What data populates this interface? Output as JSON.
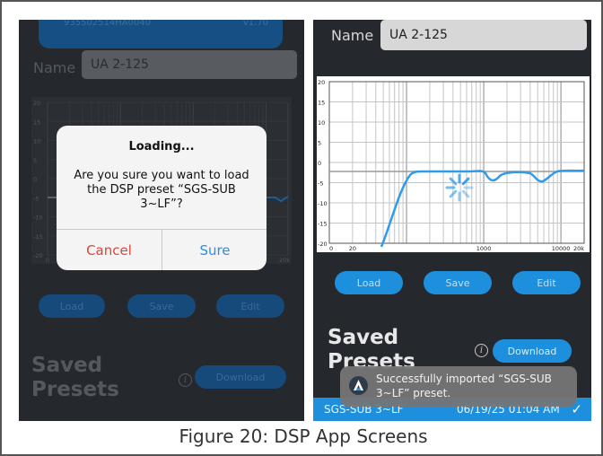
{
  "caption": "Figure 20: DSP App Screens",
  "left_screen": {
    "serial_number": "935502514HA0040",
    "firmware_version": "v1.70",
    "name_label": "Name",
    "name_value": "UA 2-125",
    "buttons": {
      "load": "Load",
      "save": "Save",
      "edit": "Edit",
      "download": "Download"
    },
    "saved_presets_title_line1": "Saved",
    "saved_presets_title_line2": "Presets",
    "info_glyph": "i",
    "modal": {
      "title": "Loading...",
      "message": "Are you sure you want to load the DSP preset “SGS-SUB 3~LF”?",
      "cancel_label": "Cancel",
      "sure_label": "Sure"
    },
    "plot_y_ticks": [
      "20",
      "15",
      "10",
      "5",
      "0",
      "-5",
      "-10",
      "-15",
      "-20"
    ],
    "plot_x_ticks": [
      "0",
      "20k"
    ]
  },
  "right_screen": {
    "name_label": "Name",
    "name_value": "UA 2-125",
    "buttons": {
      "load": "Load",
      "save": "Save",
      "edit": "Edit",
      "download": "Download"
    },
    "saved_presets_title_line1": "Saved",
    "saved_presets_title_line2": "Presets",
    "info_glyph": "i",
    "plot_y_ticks": [
      "20",
      "15",
      "10",
      "5",
      "0",
      "-5",
      "-10",
      "-15",
      "-20"
    ],
    "plot_x_ticks": [
      "0",
      "20",
      "1000",
      "10000",
      "20k"
    ],
    "toast_message": "Successfully imported “SGS-SUB 3~LF” preset.",
    "preset_row": {
      "name": "SGS-SUB 3~LF",
      "date": "06/19/25  01:04 AM",
      "check_glyph": "✓"
    }
  },
  "colors": {
    "accent_blue": "#1d8fdc",
    "cancel_red": "#e0433a",
    "sure_blue": "#2e8ee0",
    "screen_bg": "#25282d"
  }
}
